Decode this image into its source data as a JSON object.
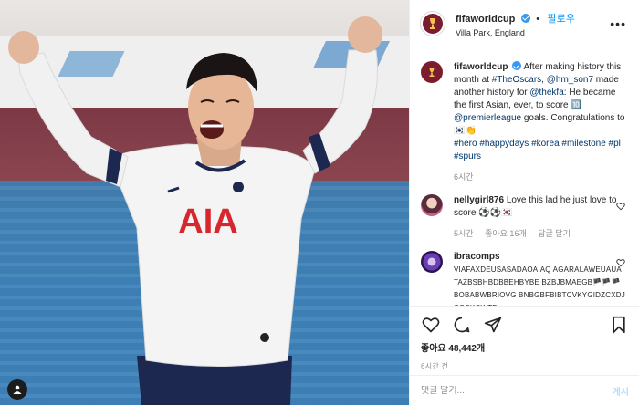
{
  "header": {
    "username": "fifaworldcup",
    "follow_label": "팔로우",
    "separator": "•",
    "location": "Villa Park, England",
    "more_label": "•••"
  },
  "caption": {
    "username": "fifaworldcup",
    "text_1": "After making history this month at ",
    "tag_oscars": "#TheOscars",
    "text_2": ", ",
    "mention_son": "@hm_son7",
    "text_3": " made another history for ",
    "mention_fa": "@thekfa",
    "text_4": ": He became the first Asian, ever, to score ",
    "score": "🔟",
    "mention_pl": "@premierleague",
    "text_5": " goals. Congratulations to ",
    "flag": "🇰🇷👏",
    "hashtags": "#hero #happydays #korea #milestone #pl #spurs",
    "time": "6시간"
  },
  "comments": [
    {
      "username": "nellygirl876",
      "text": "Love this lad he just love to score ⚽⚽🇰🇷",
      "time": "5시간",
      "likes": "좋아요 16개",
      "reply": "답글 달기"
    },
    {
      "username": "ibracomps",
      "text": "VIAFAXDEUSASADAOAIAQ AGARALAWEUAUATAZBSBHBDBBEHBYBE BZBJBMAEGB🏴🏴🏴BOBABWBRIOVG BNBGBFBIBTCVKYGIDZCXDJCCCKCWTD"
    }
  ],
  "actions": {
    "likes": "좋아요 48,442개",
    "time": "6시간 전"
  },
  "comment_box": {
    "placeholder": "댓글 달기...",
    "post_label": "게시"
  },
  "photo": {
    "jersey_sponsor": "AIA"
  },
  "colors": {
    "accent": "#0095f6",
    "brand": "#7a1d2e",
    "muted": "#8e8e8e"
  }
}
